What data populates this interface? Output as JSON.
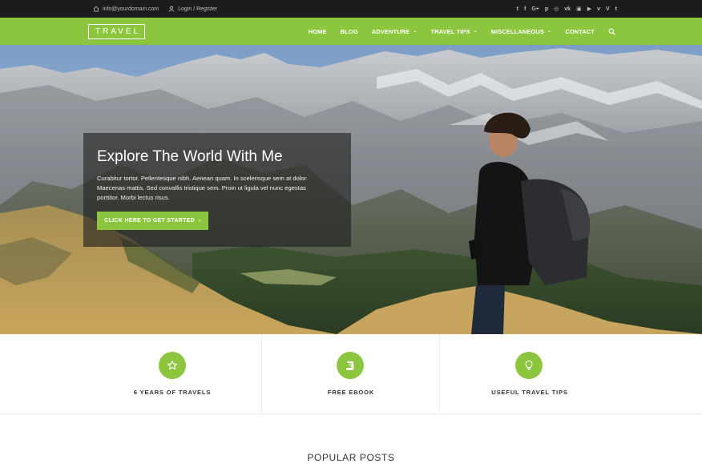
{
  "topbar": {
    "email": "info@yourdomain.com",
    "login": "Login / Register",
    "social_icons": [
      "twitter-icon",
      "facebook-icon",
      "google-plus-icon",
      "pinterest-icon",
      "dribbble-icon",
      "vk-icon",
      "instagram-icon",
      "youtube-icon",
      "vimeo-square-icon",
      "vine-icon",
      "tumblr-icon"
    ],
    "social_glyphs": [
      "t",
      "f",
      "G+",
      "p",
      "◎",
      "vk",
      "▣",
      "▶",
      "v",
      "V",
      "t"
    ]
  },
  "nav": {
    "logo": "TRAVEL",
    "items": [
      {
        "label": "HOME",
        "has_dropdown": false
      },
      {
        "label": "BLOG",
        "has_dropdown": false
      },
      {
        "label": "ADVENTURE",
        "has_dropdown": true
      },
      {
        "label": "TRAVEL TIPS",
        "has_dropdown": true
      },
      {
        "label": "MISCELLANEOUS",
        "has_dropdown": true
      },
      {
        "label": "CONTACT",
        "has_dropdown": false
      }
    ],
    "chevron": "⌄"
  },
  "hero": {
    "title": "Explore The World With Me",
    "text": "Curabitur tortor. Pellentesque nibh. Aenean quam. In scelerisque sem at dolor. Maecenas mattis. Sed convallis tristique sem. Proin ut ligula vel nunc egestas porttitor. Morbi lectus risus.",
    "cta_label": "CLICK HERE TO GET STARTED",
    "cta_arrow": "›"
  },
  "features": [
    {
      "label": "6 YEARS OF TRAVELS",
      "icon": "star-icon"
    },
    {
      "label": "FREE EBOOK",
      "icon": "book-icon"
    },
    {
      "label": "USEFUL TRAVEL TIPS",
      "icon": "lightbulb-icon"
    }
  ],
  "section_title": "POPULAR POSTS",
  "colors": {
    "accent": "#8cc63e",
    "topbar": "#1c1c1c",
    "hero_overlay": "rgba(30,30,30,0.62)"
  }
}
